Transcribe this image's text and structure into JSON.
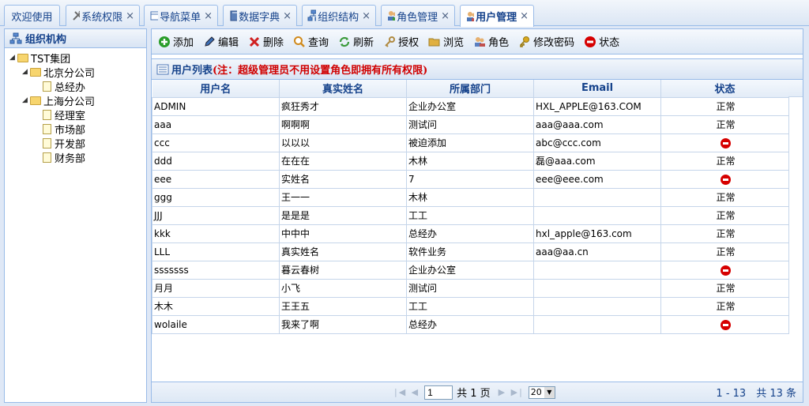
{
  "tabs": [
    {
      "label": "欢迎使用",
      "icon": "none",
      "active": false,
      "closable": false
    },
    {
      "label": "系统权限",
      "icon": "tools-icon",
      "active": false,
      "closable": true
    },
    {
      "label": "导航菜单",
      "icon": "window-icon",
      "active": false,
      "closable": true
    },
    {
      "label": "数据字典",
      "icon": "book-icon",
      "active": false,
      "closable": true
    },
    {
      "label": "组织结构",
      "icon": "org-icon",
      "active": false,
      "closable": true
    },
    {
      "label": "角色管理",
      "icon": "users-icon",
      "active": false,
      "closable": true
    },
    {
      "label": "用户管理",
      "icon": "user-group-icon",
      "active": true,
      "closable": true
    }
  ],
  "close_glyph": "×",
  "org_panel": {
    "title": "组织机构",
    "tree": [
      {
        "label": "TST集团",
        "level": 0,
        "type": "folder",
        "expanded": true
      },
      {
        "label": "北京分公司",
        "level": 1,
        "type": "folder",
        "expanded": true
      },
      {
        "label": "总经办",
        "level": 2,
        "type": "file"
      },
      {
        "label": "上海分公司",
        "level": 1,
        "type": "folder",
        "expanded": true
      },
      {
        "label": "经理室",
        "level": 2,
        "type": "file"
      },
      {
        "label": "市场部",
        "level": 2,
        "type": "file"
      },
      {
        "label": "开发部",
        "level": 2,
        "type": "file"
      },
      {
        "label": "财务部",
        "level": 2,
        "type": "file"
      }
    ]
  },
  "toolbar": [
    {
      "label": "添加",
      "icon": "add-icon",
      "color": "#2a9d2a"
    },
    {
      "label": "编辑",
      "icon": "edit-icon",
      "color": "#3b6fb6"
    },
    {
      "label": "删除",
      "icon": "delete-icon",
      "color": "#d02020"
    },
    {
      "label": "查询",
      "icon": "search-icon",
      "color": "#d08a1c"
    },
    {
      "label": "刷新",
      "icon": "refresh-icon",
      "color": "#3a9a3a"
    },
    {
      "label": "授权",
      "icon": "key-icon",
      "color": "#b08a40"
    },
    {
      "label": "浏览",
      "icon": "folder-open-icon",
      "color": "#e0b040"
    },
    {
      "label": "角色",
      "icon": "role-icon",
      "color": "#5a7fc0"
    },
    {
      "label": "修改密码",
      "icon": "password-key-icon",
      "color": "#d8a820"
    },
    {
      "label": "状态",
      "icon": "status-icon",
      "color": "#d60000"
    }
  ],
  "user_list": {
    "title": "用户列表",
    "note": "(注：超级管理员不用设置角色即拥有所有权限)",
    "columns": [
      "用户名",
      "真实姓名",
      "所属部门",
      "Email",
      "状态"
    ],
    "status_normal": "正常",
    "rows": [
      {
        "username": "ADMIN",
        "realname": "疯狂秀才",
        "dept": "企业办公室",
        "email": "HXL_APPLE@163.COM",
        "status": "正常"
      },
      {
        "username": "aaa",
        "realname": "啊啊啊",
        "dept": "测试问",
        "email": "aaa@aaa.com",
        "status": "正常"
      },
      {
        "username": "ccc",
        "realname": "以以以",
        "dept": "被迫添加",
        "email": "abc@ccc.com",
        "status": "disabled"
      },
      {
        "username": "ddd",
        "realname": "在在在",
        "dept": "木林",
        "email": "磊@aaa.com",
        "status": "正常"
      },
      {
        "username": "eee",
        "realname": "实姓名",
        "dept": "7",
        "email": "eee@eee.com",
        "status": "disabled"
      },
      {
        "username": "ggg",
        "realname": "王一一",
        "dept": "木林",
        "email": "",
        "status": "正常"
      },
      {
        "username": "JJJ",
        "realname": "是是是",
        "dept": "工工",
        "email": "",
        "status": "正常"
      },
      {
        "username": "kkk",
        "realname": "中中中",
        "dept": "总经办",
        "email": "hxl_apple@163.com",
        "status": "正常"
      },
      {
        "username": "LLL",
        "realname": "真实姓名",
        "dept": "软件业务",
        "email": "aaa@aa.cn",
        "status": "正常"
      },
      {
        "username": "sssssss",
        "realname": "暮云春树",
        "dept": "企业办公室",
        "email": "",
        "status": "disabled"
      },
      {
        "username": "月月",
        "realname": "小飞",
        "dept": "测试问",
        "email": "",
        "status": "正常"
      },
      {
        "username": "木木",
        "realname": "王王五",
        "dept": "工工",
        "email": "",
        "status": "正常"
      },
      {
        "username": "wolaile",
        "realname": "我来了啊",
        "dept": "总经办",
        "email": "",
        "status": "disabled"
      }
    ]
  },
  "pager": {
    "first_prev": "|◀ ◀",
    "page_value": "1",
    "total_pages": "共 1 页",
    "next_last": "▶ ▶|",
    "page_size": "20",
    "summary": "1 - 13　共 13 条"
  }
}
